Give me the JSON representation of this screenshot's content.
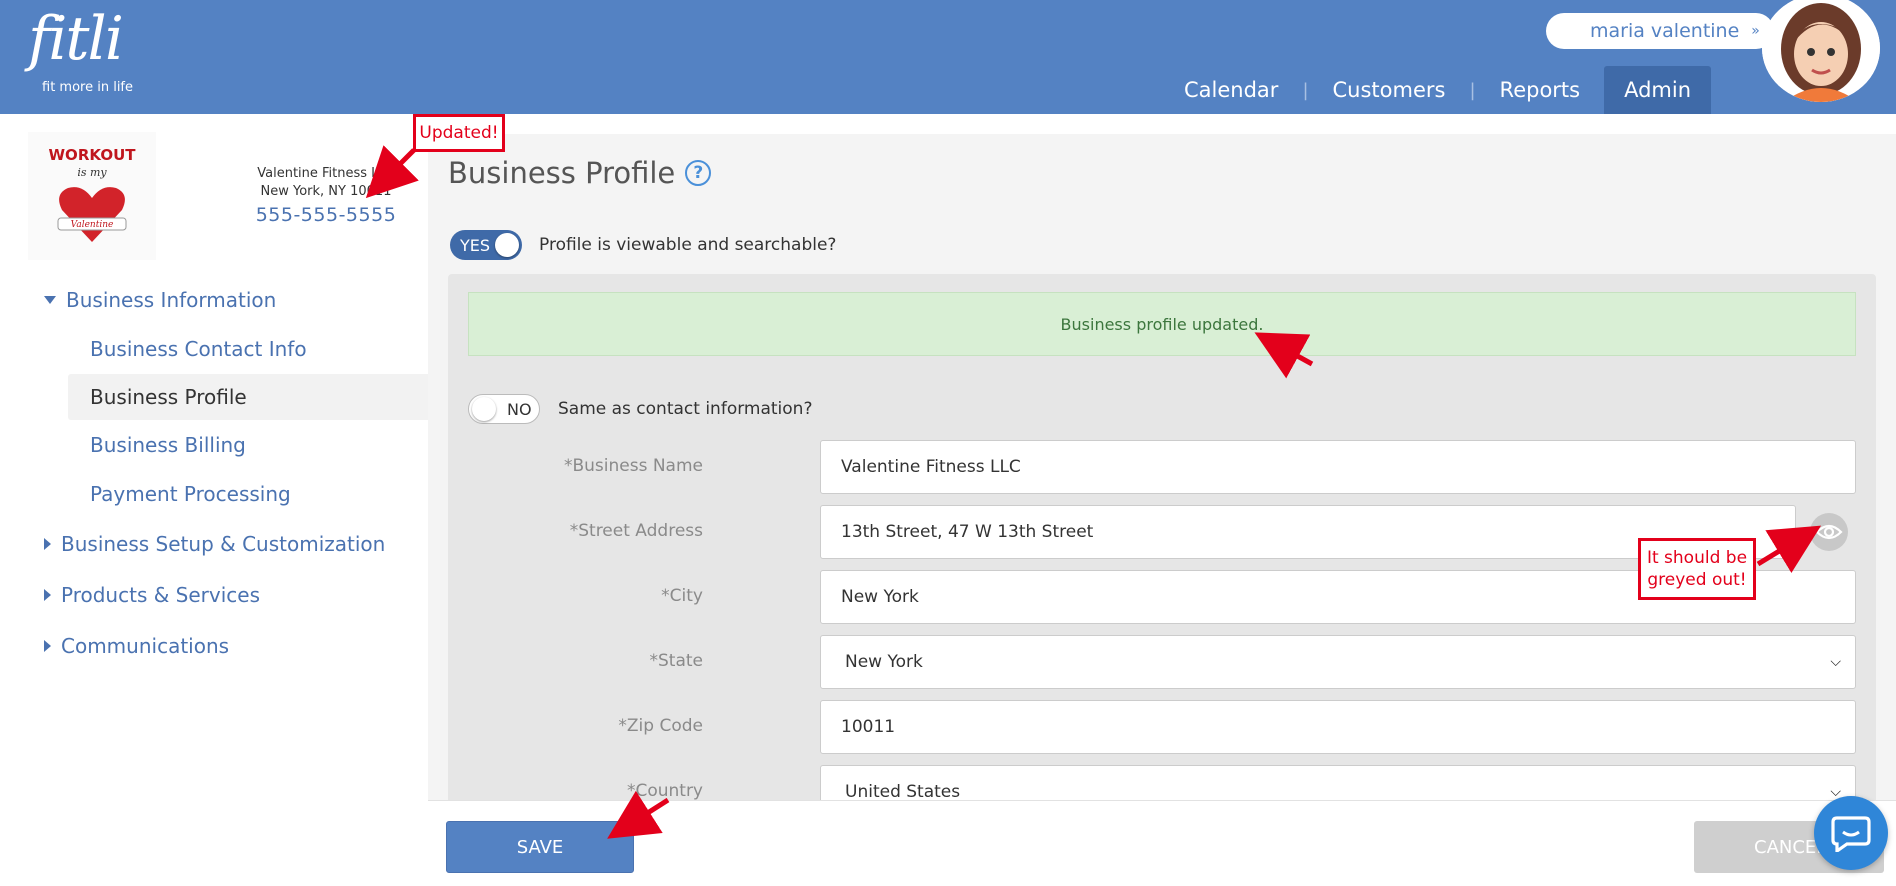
{
  "header": {
    "logo_text": "fitli",
    "logo_tagline": "fit more in life",
    "user_name": "maria valentine",
    "nav": [
      {
        "label": "Calendar"
      },
      {
        "label": "Customers"
      },
      {
        "label": "Reports"
      },
      {
        "label": "Admin",
        "active": true
      }
    ]
  },
  "business_card": {
    "logo_text": "WORKOUT is my Valentine",
    "name": "Valentine Fitness LLC",
    "city_line": "New York, NY 10011",
    "phone": "555-555-5555"
  },
  "sidebar": {
    "groups": [
      {
        "label": "Business Information",
        "expanded": true
      },
      {
        "label": "Business Setup & Customization",
        "expanded": false
      },
      {
        "label": "Products & Services",
        "expanded": false
      },
      {
        "label": "Communications",
        "expanded": false
      }
    ],
    "sub_items": [
      {
        "label": "Business Contact Info"
      },
      {
        "label": "Business Profile",
        "active": true
      },
      {
        "label": "Business Billing"
      },
      {
        "label": "Payment Processing"
      }
    ]
  },
  "main": {
    "title": "Business Profile",
    "help_glyph": "?",
    "viewable_toggle": {
      "state": "YES",
      "label": "Profile is viewable and searchable?"
    },
    "alert": "Business profile updated.",
    "same_as_toggle": {
      "state": "NO",
      "label": "Same as contact information?"
    },
    "fields": {
      "business_name": {
        "label": "*Business Name",
        "value": "Valentine Fitness LLC"
      },
      "street_address": {
        "label": "*Street Address",
        "value": "13th Street, 47 W 13th Street"
      },
      "city": {
        "label": "*City",
        "value": "New York"
      },
      "state": {
        "label": "*State",
        "value": "New York"
      },
      "zip": {
        "label": "*Zip Code",
        "value": "10011"
      },
      "country": {
        "label": "*Country",
        "value": "United States"
      }
    }
  },
  "footer": {
    "save_label": "SAVE",
    "cancel_label": "CANCEL"
  },
  "annotations": {
    "updated_note": "Updated!",
    "greyed_note_line1": "It should be",
    "greyed_note_line2": "greyed out!",
    "color": "#e3001b"
  },
  "colors": {
    "header_bg": "#5482c3",
    "accent": "#4a72b0",
    "alert_bg": "#d9efd5",
    "alert_text": "#3c763d"
  }
}
